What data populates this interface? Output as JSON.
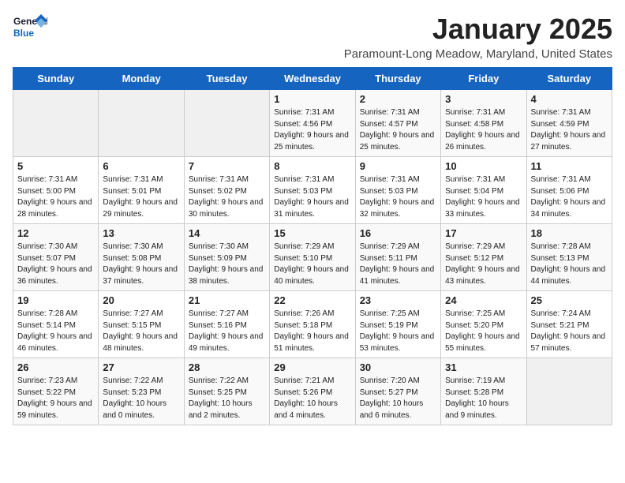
{
  "logo": {
    "general": "General",
    "blue": "Blue"
  },
  "header": {
    "month": "January 2025",
    "location": "Paramount-Long Meadow, Maryland, United States"
  },
  "weekdays": [
    "Sunday",
    "Monday",
    "Tuesday",
    "Wednesday",
    "Thursday",
    "Friday",
    "Saturday"
  ],
  "weeks": [
    [
      {
        "day": "",
        "content": ""
      },
      {
        "day": "",
        "content": ""
      },
      {
        "day": "",
        "content": ""
      },
      {
        "day": "1",
        "content": "Sunrise: 7:31 AM\nSunset: 4:56 PM\nDaylight: 9 hours and 25 minutes."
      },
      {
        "day": "2",
        "content": "Sunrise: 7:31 AM\nSunset: 4:57 PM\nDaylight: 9 hours and 25 minutes."
      },
      {
        "day": "3",
        "content": "Sunrise: 7:31 AM\nSunset: 4:58 PM\nDaylight: 9 hours and 26 minutes."
      },
      {
        "day": "4",
        "content": "Sunrise: 7:31 AM\nSunset: 4:59 PM\nDaylight: 9 hours and 27 minutes."
      }
    ],
    [
      {
        "day": "5",
        "content": "Sunrise: 7:31 AM\nSunset: 5:00 PM\nDaylight: 9 hours and 28 minutes."
      },
      {
        "day": "6",
        "content": "Sunrise: 7:31 AM\nSunset: 5:01 PM\nDaylight: 9 hours and 29 minutes."
      },
      {
        "day": "7",
        "content": "Sunrise: 7:31 AM\nSunset: 5:02 PM\nDaylight: 9 hours and 30 minutes."
      },
      {
        "day": "8",
        "content": "Sunrise: 7:31 AM\nSunset: 5:03 PM\nDaylight: 9 hours and 31 minutes."
      },
      {
        "day": "9",
        "content": "Sunrise: 7:31 AM\nSunset: 5:03 PM\nDaylight: 9 hours and 32 minutes."
      },
      {
        "day": "10",
        "content": "Sunrise: 7:31 AM\nSunset: 5:04 PM\nDaylight: 9 hours and 33 minutes."
      },
      {
        "day": "11",
        "content": "Sunrise: 7:31 AM\nSunset: 5:06 PM\nDaylight: 9 hours and 34 minutes."
      }
    ],
    [
      {
        "day": "12",
        "content": "Sunrise: 7:30 AM\nSunset: 5:07 PM\nDaylight: 9 hours and 36 minutes."
      },
      {
        "day": "13",
        "content": "Sunrise: 7:30 AM\nSunset: 5:08 PM\nDaylight: 9 hours and 37 minutes."
      },
      {
        "day": "14",
        "content": "Sunrise: 7:30 AM\nSunset: 5:09 PM\nDaylight: 9 hours and 38 minutes."
      },
      {
        "day": "15",
        "content": "Sunrise: 7:29 AM\nSunset: 5:10 PM\nDaylight: 9 hours and 40 minutes."
      },
      {
        "day": "16",
        "content": "Sunrise: 7:29 AM\nSunset: 5:11 PM\nDaylight: 9 hours and 41 minutes."
      },
      {
        "day": "17",
        "content": "Sunrise: 7:29 AM\nSunset: 5:12 PM\nDaylight: 9 hours and 43 minutes."
      },
      {
        "day": "18",
        "content": "Sunrise: 7:28 AM\nSunset: 5:13 PM\nDaylight: 9 hours and 44 minutes."
      }
    ],
    [
      {
        "day": "19",
        "content": "Sunrise: 7:28 AM\nSunset: 5:14 PM\nDaylight: 9 hours and 46 minutes."
      },
      {
        "day": "20",
        "content": "Sunrise: 7:27 AM\nSunset: 5:15 PM\nDaylight: 9 hours and 48 minutes."
      },
      {
        "day": "21",
        "content": "Sunrise: 7:27 AM\nSunset: 5:16 PM\nDaylight: 9 hours and 49 minutes."
      },
      {
        "day": "22",
        "content": "Sunrise: 7:26 AM\nSunset: 5:18 PM\nDaylight: 9 hours and 51 minutes."
      },
      {
        "day": "23",
        "content": "Sunrise: 7:25 AM\nSunset: 5:19 PM\nDaylight: 9 hours and 53 minutes."
      },
      {
        "day": "24",
        "content": "Sunrise: 7:25 AM\nSunset: 5:20 PM\nDaylight: 9 hours and 55 minutes."
      },
      {
        "day": "25",
        "content": "Sunrise: 7:24 AM\nSunset: 5:21 PM\nDaylight: 9 hours and 57 minutes."
      }
    ],
    [
      {
        "day": "26",
        "content": "Sunrise: 7:23 AM\nSunset: 5:22 PM\nDaylight: 9 hours and 59 minutes."
      },
      {
        "day": "27",
        "content": "Sunrise: 7:22 AM\nSunset: 5:23 PM\nDaylight: 10 hours and 0 minutes."
      },
      {
        "day": "28",
        "content": "Sunrise: 7:22 AM\nSunset: 5:25 PM\nDaylight: 10 hours and 2 minutes."
      },
      {
        "day": "29",
        "content": "Sunrise: 7:21 AM\nSunset: 5:26 PM\nDaylight: 10 hours and 4 minutes."
      },
      {
        "day": "30",
        "content": "Sunrise: 7:20 AM\nSunset: 5:27 PM\nDaylight: 10 hours and 6 minutes."
      },
      {
        "day": "31",
        "content": "Sunrise: 7:19 AM\nSunset: 5:28 PM\nDaylight: 10 hours and 9 minutes."
      },
      {
        "day": "",
        "content": ""
      }
    ]
  ]
}
